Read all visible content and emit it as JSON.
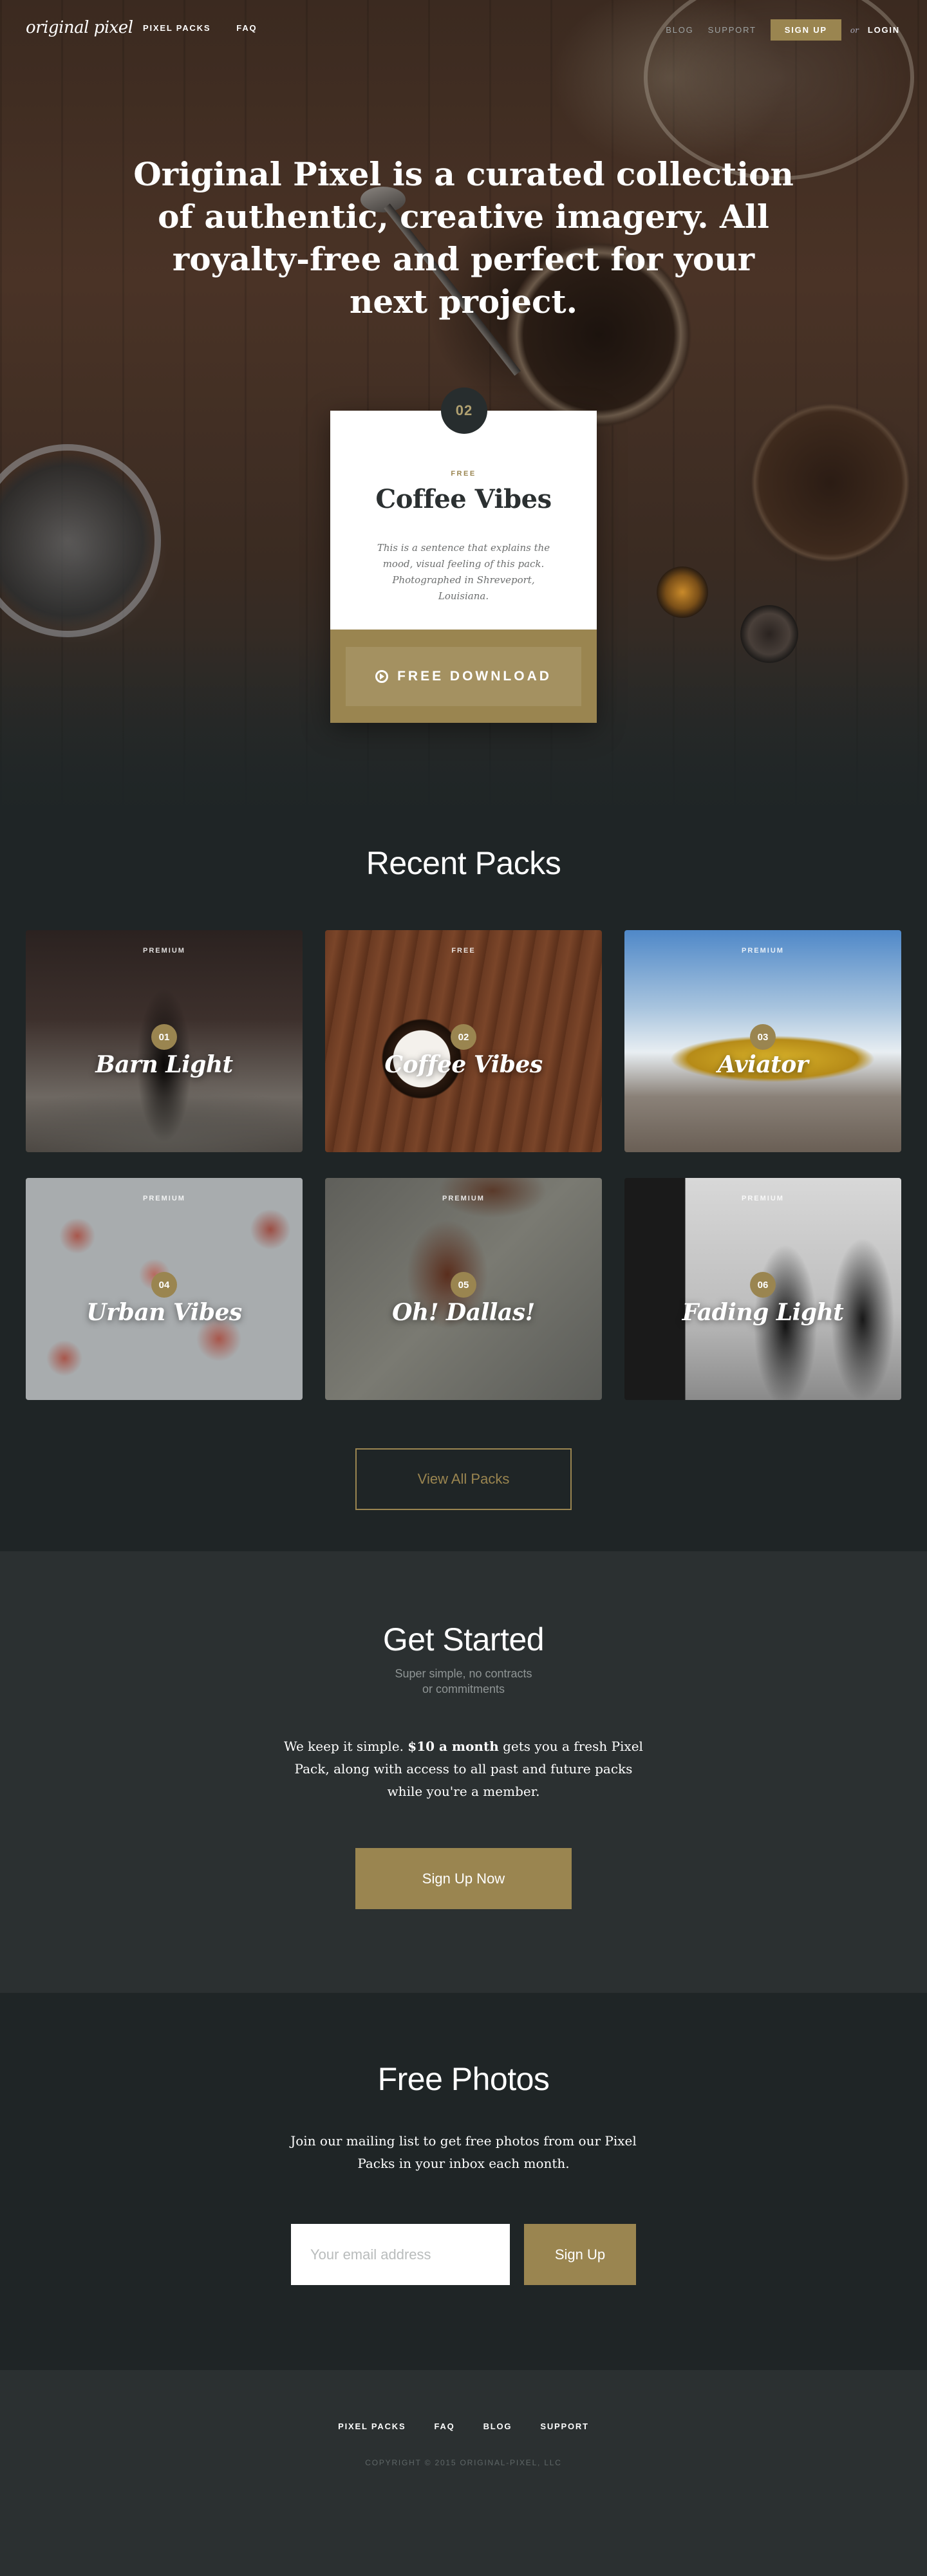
{
  "nav": {
    "logo": "original pixel",
    "left_links": [
      "PIXEL PACKS",
      "FAQ"
    ],
    "blog": "BLOG",
    "support": "SUPPORT",
    "signup": "SIGN UP",
    "or": "or",
    "login": "LOGIN"
  },
  "hero": {
    "headline": "Original Pixel is a curated collection of authentic, creative imagery. All royalty-free and perfect for your next project."
  },
  "featured": {
    "number": "02",
    "label": "FREE",
    "name": "Coffee Vibes",
    "description": "This is a sentence that explains the mood, visual feeling of this pack. Photographed in Shreveport, Louisiana.",
    "download_label": "FREE DOWNLOAD"
  },
  "recent": {
    "title": "Recent Packs",
    "packs": [
      {
        "tag": "PREMIUM",
        "number": "01",
        "name": "Barn Light"
      },
      {
        "tag": "FREE",
        "number": "02",
        "name": "Coffee Vibes"
      },
      {
        "tag": "PREMIUM",
        "number": "03",
        "name": "Aviator"
      },
      {
        "tag": "PREMIUM",
        "number": "04",
        "name": "Urban Vibes"
      },
      {
        "tag": "PREMIUM",
        "number": "05",
        "name": "Oh! Dallas!"
      },
      {
        "tag": "PREMIUM",
        "number": "06",
        "name": "Fading Light"
      }
    ],
    "view_all": "View All Packs"
  },
  "get_started": {
    "title": "Get Started",
    "subtitle_line1": "Super simple, no contracts",
    "subtitle_line2": "or commitments",
    "body_pre": "We keep it simple.",
    "body_bold": "$10 a month",
    "body_post": "gets you a fresh Pixel Pack, along with access to all past and future packs while you're a member.",
    "button": "Sign Up Now"
  },
  "free_photos": {
    "title": "Free Photos",
    "body": "Join our mailing list to get free photos from our Pixel Packs in your inbox each month.",
    "email_placeholder": "Your email address",
    "button": "Sign Up"
  },
  "footer": {
    "links": [
      "PIXEL PACKS",
      "FAQ",
      "BLOG",
      "SUPPORT"
    ],
    "copyright": "COPYRIGHT © 2015 ORIGINAL-PIXEL, LLC"
  },
  "colors": {
    "accent": "#9a8550",
    "dark": "#1f2526",
    "darker_panel": "#2b3031"
  }
}
